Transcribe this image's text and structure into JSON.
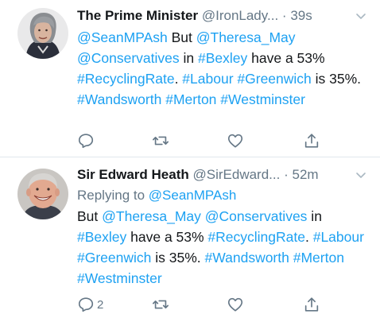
{
  "tweets": [
    {
      "name": "The Prime Minister",
      "handle": "@IronLady...",
      "dot": "·",
      "time": "39s",
      "text": [
        {
          "t": "@SeanMPAsh",
          "link": true
        },
        {
          "t": " But ",
          "link": false
        },
        {
          "t": "@Theresa_May",
          "link": true
        },
        {
          "t": " ",
          "link": false
        },
        {
          "t": "@Conservatives",
          "link": true
        },
        {
          "t": " in ",
          "link": false
        },
        {
          "t": "#Bexley",
          "link": true
        },
        {
          "t": " have a 53% ",
          "link": false
        },
        {
          "t": "#RecyclingRate",
          "link": true
        },
        {
          "t": ". ",
          "link": false
        },
        {
          "t": "#Labour",
          "link": true
        },
        {
          "t": " ",
          "link": false
        },
        {
          "t": "#Greenwich",
          "link": true
        },
        {
          "t": " is 35%. ",
          "link": false
        },
        {
          "t": "#Wandsworth",
          "link": true
        },
        {
          "t": " ",
          "link": false
        },
        {
          "t": "#Merton",
          "link": true
        },
        {
          "t": " ",
          "link": false
        },
        {
          "t": "#Westminster",
          "link": true
        }
      ],
      "reply_count": ""
    },
    {
      "name": "Sir Edward Heath",
      "handle": "@SirEdward...",
      "dot": "·",
      "time": "52m",
      "replying_prefix": "Replying to ",
      "replying_to": "@SeanMPAsh",
      "text": [
        {
          "t": "But ",
          "link": false
        },
        {
          "t": "@Theresa_May",
          "link": true
        },
        {
          "t": " ",
          "link": false
        },
        {
          "t": "@Conservatives",
          "link": true
        },
        {
          "t": " in ",
          "link": false
        },
        {
          "t": "#Bexley",
          "link": true
        },
        {
          "t": " have a 53% ",
          "link": false
        },
        {
          "t": "#RecyclingRate",
          "link": true
        },
        {
          "t": ". ",
          "link": false
        },
        {
          "t": "#Labour",
          "link": true
        },
        {
          "t": " ",
          "link": false
        },
        {
          "t": "#Greenwich",
          "link": true
        },
        {
          "t": " is 35%. ",
          "link": false
        },
        {
          "t": "#Wandsworth",
          "link": true
        },
        {
          "t": " ",
          "link": false
        },
        {
          "t": "#Merton",
          "link": true
        },
        {
          "t": " ",
          "link": false
        },
        {
          "t": "#Westminster",
          "link": true
        }
      ],
      "reply_count": "2"
    }
  ],
  "icons": {
    "reply": "reply-icon",
    "retweet": "retweet-icon",
    "like": "heart-icon",
    "share": "share-icon",
    "menu": "chevron-down-icon"
  },
  "colors": {
    "link": "#1da1f2",
    "text": "#14171a",
    "muted": "#657786",
    "divider": "#e1e8ed"
  }
}
